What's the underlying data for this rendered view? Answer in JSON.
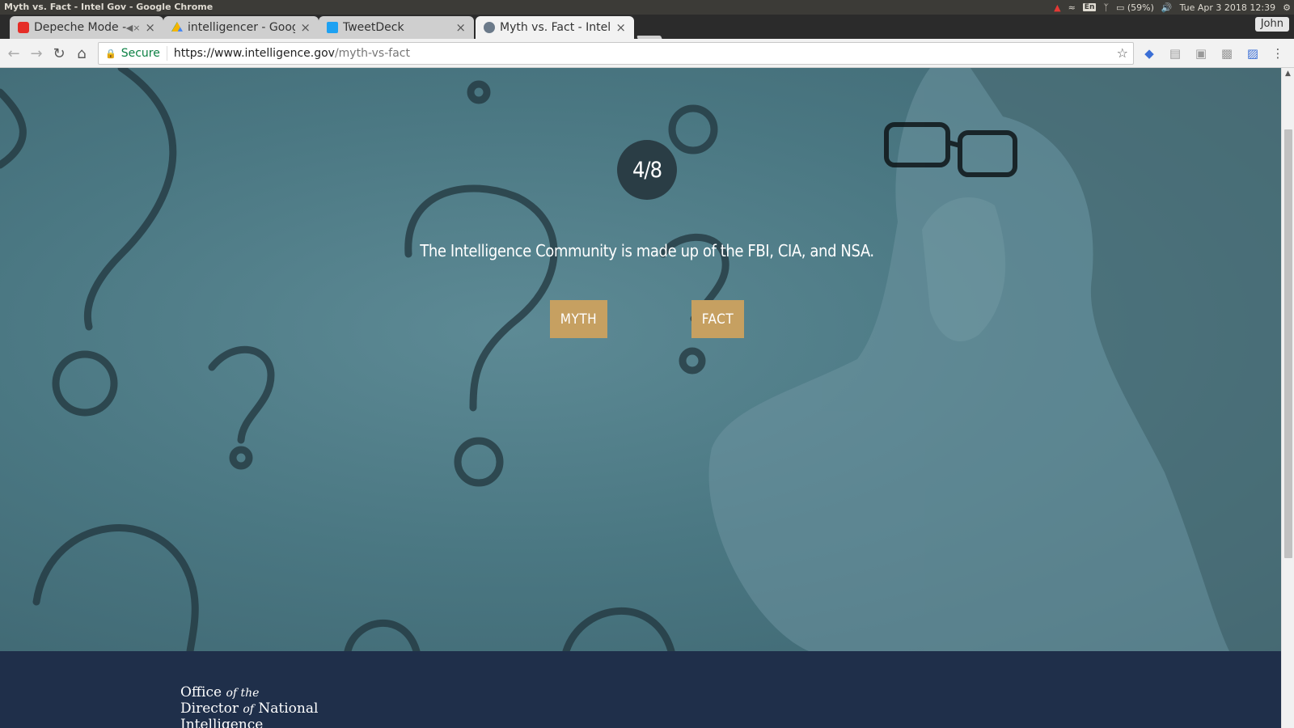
{
  "os": {
    "window_title": "Myth vs. Fact - Intel Gov - Google Chrome",
    "keyboard_layout": "En",
    "battery": "(59%)",
    "datetime": "Tue Apr  3 2018 12:39"
  },
  "browser": {
    "tabs": [
      {
        "title": "Depeche Mode - I",
        "favicon": "youtube-icon",
        "muted": true,
        "active": false
      },
      {
        "title": "intelligencer - Goog",
        "favicon": "google-drive-icon",
        "active": false
      },
      {
        "title": "TweetDeck",
        "favicon": "twitter-icon",
        "active": false
      },
      {
        "title": "Myth vs. Fact - Intel",
        "favicon": "globe-icon",
        "active": true
      }
    ],
    "profile_name": "John",
    "secure_label": "Secure",
    "url_scheme_host": "https://www.intelligence.gov",
    "url_path": "/myth-vs-fact"
  },
  "quiz": {
    "progress": "4/8",
    "question": "The Intelligence Community is made up of the FBI, CIA, and NSA.",
    "myth_label": "MYTH",
    "fact_label": "FACT"
  },
  "footer": {
    "logo_line1_a": "Office",
    "logo_line1_b": "of the",
    "logo_line2_a": "Director",
    "logo_line2_b": "of",
    "logo_line2_c": "National Intelligence"
  },
  "colors": {
    "hero_teal": "#4a7782",
    "button_gold": "#c6a061",
    "footer_navy": "#1f2f4a",
    "counter_dark": "#2a3d45"
  }
}
